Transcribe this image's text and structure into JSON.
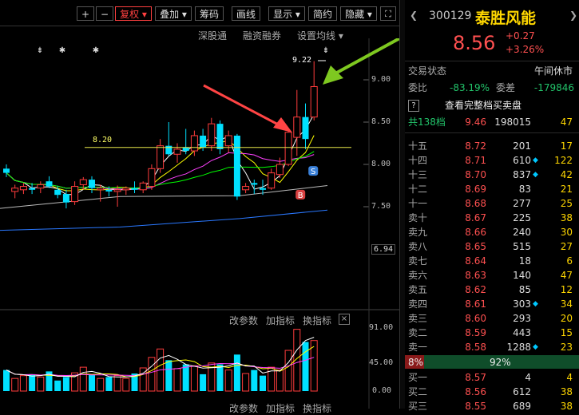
{
  "toolbar": {
    "plus_label": "+",
    "minus_label": "−",
    "restore_label": "复权",
    "overlay_label": "叠加",
    "chips_label": "筹码",
    "draw_label": "画线",
    "display_label": "显示",
    "simple_label": "简约",
    "hide_label": "隐藏"
  },
  "sub_links": {
    "shengu": "深股通",
    "margin": "融资融券",
    "settings": "设置均线"
  },
  "chart_data": {
    "type": "candlestick",
    "ylim": [
      6.94,
      9.22
    ],
    "y_ticks": [
      "9.00",
      "8.50",
      "8.00",
      "7.50",
      "6.94"
    ],
    "high_label": "9.22",
    "ref_line_label": "8.20",
    "ref_line_value": 8.2,
    "candles": [
      {
        "o": 7.95,
        "h": 8.0,
        "l": 7.85,
        "c": 7.9
      },
      {
        "o": 7.68,
        "h": 7.76,
        "l": 7.6,
        "c": 7.72
      },
      {
        "o": 7.7,
        "h": 7.78,
        "l": 7.65,
        "c": 7.74
      },
      {
        "o": 7.72,
        "h": 7.78,
        "l": 7.65,
        "c": 7.7
      },
      {
        "o": 7.72,
        "h": 7.8,
        "l": 7.66,
        "c": 7.76
      },
      {
        "o": 7.8,
        "h": 7.86,
        "l": 7.72,
        "c": 7.74
      },
      {
        "o": 7.7,
        "h": 7.74,
        "l": 7.6,
        "c": 7.64
      },
      {
        "o": 7.65,
        "h": 7.7,
        "l": 7.48,
        "c": 7.55
      },
      {
        "o": 7.56,
        "h": 7.8,
        "l": 7.52,
        "c": 7.74
      },
      {
        "o": 7.76,
        "h": 7.85,
        "l": 7.7,
        "c": 7.82
      },
      {
        "o": 7.82,
        "h": 7.86,
        "l": 7.66,
        "c": 7.72
      },
      {
        "o": 7.7,
        "h": 7.76,
        "l": 7.56,
        "c": 7.72
      },
      {
        "o": 7.7,
        "h": 7.74,
        "l": 7.62,
        "c": 7.68
      },
      {
        "o": 7.68,
        "h": 7.75,
        "l": 7.5,
        "c": 7.7
      },
      {
        "o": 7.7,
        "h": 7.74,
        "l": 7.64,
        "c": 7.72
      },
      {
        "o": 7.72,
        "h": 7.8,
        "l": 7.66,
        "c": 7.7
      },
      {
        "o": 7.7,
        "h": 7.8,
        "l": 7.66,
        "c": 7.78
      },
      {
        "o": 7.74,
        "h": 8.0,
        "l": 7.7,
        "c": 7.95
      },
      {
        "o": 7.95,
        "h": 8.3,
        "l": 7.9,
        "c": 8.22
      },
      {
        "o": 8.22,
        "h": 8.5,
        "l": 8.1,
        "c": 8.12
      },
      {
        "o": 8.12,
        "h": 8.25,
        "l": 8.02,
        "c": 8.18
      },
      {
        "o": 8.2,
        "h": 8.42,
        "l": 8.12,
        "c": 8.16
      },
      {
        "o": 8.16,
        "h": 8.4,
        "l": 8.1,
        "c": 8.34
      },
      {
        "o": 8.34,
        "h": 8.42,
        "l": 8.16,
        "c": 8.2
      },
      {
        "o": 8.22,
        "h": 8.55,
        "l": 8.16,
        "c": 8.48
      },
      {
        "o": 8.48,
        "h": 8.52,
        "l": 8.12,
        "c": 8.18
      },
      {
        "o": 8.22,
        "h": 8.4,
        "l": 8.14,
        "c": 8.34
      },
      {
        "o": 8.34,
        "h": 8.36,
        "l": 7.58,
        "c": 7.62
      },
      {
        "o": 7.7,
        "h": 7.78,
        "l": 7.66,
        "c": 7.74
      },
      {
        "o": 7.78,
        "h": 7.82,
        "l": 7.65,
        "c": 7.76
      },
      {
        "o": 7.72,
        "h": 7.82,
        "l": 7.64,
        "c": 7.7
      },
      {
        "o": 7.72,
        "h": 7.95,
        "l": 7.7,
        "c": 7.9
      },
      {
        "o": 7.88,
        "h": 8.08,
        "l": 7.84,
        "c": 8.0
      },
      {
        "o": 8.0,
        "h": 8.4,
        "l": 7.98,
        "c": 8.38
      },
      {
        "o": 8.32,
        "h": 8.88,
        "l": 8.1,
        "c": 8.56
      },
      {
        "o": 8.56,
        "h": 8.72,
        "l": 8.18,
        "c": 8.3
      },
      {
        "o": 8.56,
        "h": 9.22,
        "l": 8.52,
        "c": 8.92
      }
    ],
    "volume_ticks": [
      "91.00",
      "45.00",
      "0.00"
    ],
    "volume": [
      30,
      18,
      22,
      24,
      20,
      28,
      15,
      20,
      26,
      34,
      24,
      18,
      20,
      22,
      18,
      25,
      33,
      48,
      60,
      44,
      32,
      38,
      36,
      24,
      40,
      38,
      30,
      52,
      25,
      30,
      22,
      34,
      30,
      58,
      88,
      70,
      72
    ]
  },
  "indicator_bar": {
    "params": "改参数",
    "add": "加指标",
    "switch": "换指标",
    "close_icon": "close-icon"
  },
  "indicator_bar_bottom": {
    "params": "改参数",
    "add": "加指标",
    "switch": "换指标"
  },
  "quote": {
    "code": "300129",
    "name": "泰胜风能",
    "price": "8.56",
    "change": "+0.27",
    "change_pct": "+3.26%",
    "status_label": "交易状态",
    "status_value": "午间休市",
    "ratio_label": "委比",
    "ratio_value": "-83.19%",
    "diff_label": "委差",
    "diff_value": "-179846",
    "full_book_label": "查看完整档买卖盘",
    "total_label": "共138档",
    "total_price": "9.46",
    "total_vol": "198015",
    "total_cnt": "47"
  },
  "order_book": {
    "asks": [
      {
        "level": "十五",
        "price": "8.72",
        "vol": "201",
        "cnt": "17",
        "dot": false
      },
      {
        "level": "十四",
        "price": "8.71",
        "vol": "610",
        "cnt": "122",
        "dot": true
      },
      {
        "level": "十三",
        "price": "8.70",
        "vol": "837",
        "cnt": "42",
        "dot": true
      },
      {
        "level": "十二",
        "price": "8.69",
        "vol": "83",
        "cnt": "21",
        "dot": false
      },
      {
        "level": "十一",
        "price": "8.68",
        "vol": "277",
        "cnt": "25",
        "dot": false
      },
      {
        "level": "卖十",
        "price": "8.67",
        "vol": "225",
        "cnt": "38",
        "dot": false
      },
      {
        "level": "卖九",
        "price": "8.66",
        "vol": "240",
        "cnt": "30",
        "dot": false
      },
      {
        "level": "卖八",
        "price": "8.65",
        "vol": "515",
        "cnt": "27",
        "dot": false
      },
      {
        "level": "卖七",
        "price": "8.64",
        "vol": "18",
        "cnt": "6",
        "dot": false
      },
      {
        "level": "卖六",
        "price": "8.63",
        "vol": "140",
        "cnt": "47",
        "dot": false
      },
      {
        "level": "卖五",
        "price": "8.62",
        "vol": "85",
        "cnt": "12",
        "dot": false
      },
      {
        "level": "卖四",
        "price": "8.61",
        "vol": "303",
        "cnt": "34",
        "dot": true
      },
      {
        "level": "卖三",
        "price": "8.60",
        "vol": "293",
        "cnt": "20",
        "dot": false
      },
      {
        "level": "卖二",
        "price": "8.59",
        "vol": "443",
        "cnt": "15",
        "dot": false
      },
      {
        "level": "卖一",
        "price": "8.58",
        "vol": "1288",
        "cnt": "23",
        "dot": true
      }
    ],
    "bar_left": "8%",
    "bar_right": "92%",
    "bids": [
      {
        "level": "买一",
        "price": "8.57",
        "vol": "4",
        "cnt": "4",
        "dot": false
      },
      {
        "level": "买二",
        "price": "8.56",
        "vol": "612",
        "cnt": "38",
        "dot": false
      },
      {
        "level": "买三",
        "price": "8.55",
        "vol": "689",
        "cnt": "38",
        "dot": false
      }
    ]
  },
  "colors": {
    "up": "#ff3c3c",
    "down": "#00e0ff",
    "price_red": "#ff5050",
    "volume_cyan": "#00e0ff",
    "bid_green": "#22c36a",
    "ask_red": "#ff5050"
  }
}
